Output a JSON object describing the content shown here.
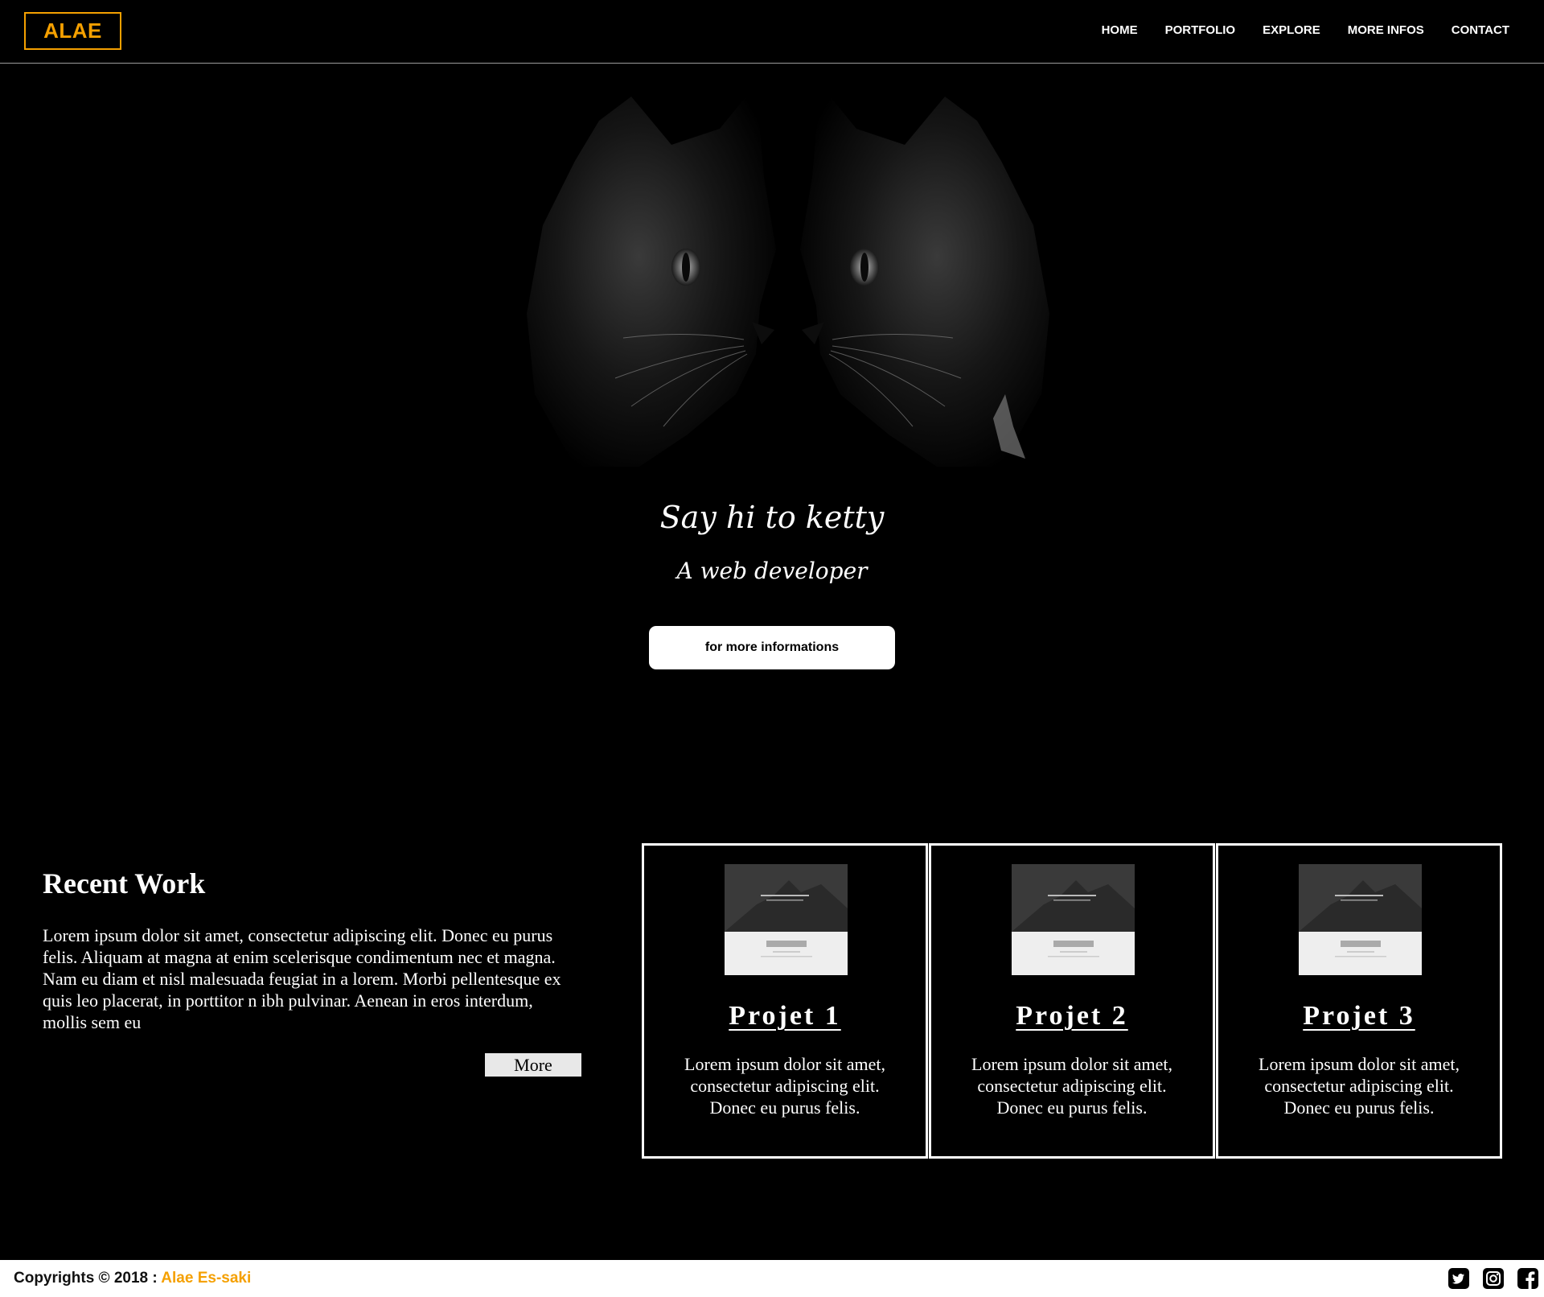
{
  "brand": {
    "logo_text": "ALAE",
    "accent_color": "#f5a000"
  },
  "nav": {
    "items": [
      "HOME",
      "PORTFOLIO",
      "EXPLORE",
      "MORE INFOS",
      "CONTACT"
    ]
  },
  "hero": {
    "image": "two-black-cats-mirrored",
    "title": "Say hi to ketty",
    "subtitle": "A web developer",
    "cta_label": "for more informations"
  },
  "recent_work": {
    "title": "Recent Work",
    "text": "Lorem ipsum dolor sit amet, consectetur adipiscing elit. Donec eu purus felis. Aliquam at magna at enim scelerisque condimentum nec et magna. Nam eu diam et nisl malesuada feugiat in a lorem. Morbi pellentesque ex quis leo placerat, in porttitor n ibh pulvinar. Aenean in eros interdum, mollis sem eu",
    "more_label": "More"
  },
  "projects": [
    {
      "title": "Projet 1",
      "description": "Lorem ipsum dolor sit amet, consectetur adipiscing elit. Donec eu purus felis.",
      "thumbnail": "website-screenshot-thumbnail"
    },
    {
      "title": "Projet 2",
      "description": "Lorem ipsum dolor sit amet, consectetur adipiscing elit. Donec eu purus felis.",
      "thumbnail": "website-screenshot-thumbnail"
    },
    {
      "title": "Projet 3",
      "description": "Lorem ipsum dolor sit amet, consectetur adipiscing elit. Donec eu purus felis.",
      "thumbnail": "website-screenshot-thumbnail"
    }
  ],
  "footer": {
    "copyright_prefix": "Copyrights © 2018 : ",
    "author": "Alae Es-saki",
    "social": [
      "twitter-icon",
      "instagram-icon",
      "facebook-icon"
    ]
  }
}
